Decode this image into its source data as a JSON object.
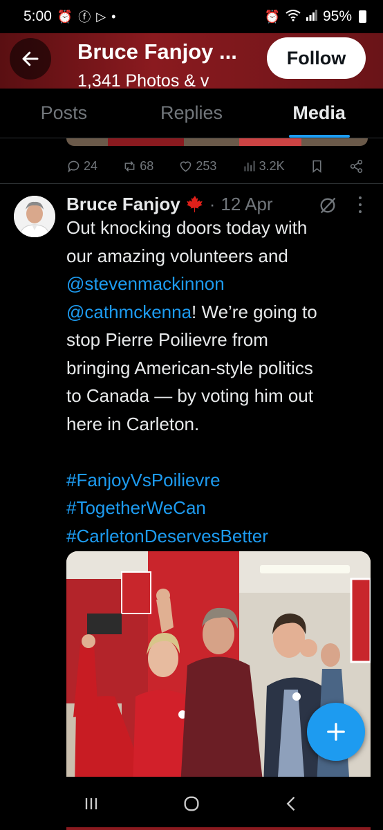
{
  "status_bar": {
    "time": "5:00",
    "dot": "•",
    "battery": "95%",
    "icons": [
      "alarm-icon",
      "facebook-icon",
      "play-icon",
      "wifi-icon",
      "signal-icon",
      "battery-icon"
    ]
  },
  "header": {
    "title": "Bruce Fanjoy ...",
    "subtitle": "1,341 Photos & v",
    "follow_label": "Follow"
  },
  "tabs": [
    {
      "label": "Posts",
      "active": false
    },
    {
      "label": "Replies",
      "active": false
    },
    {
      "label": "Media",
      "active": true
    }
  ],
  "prev_post_actions": {
    "replies": "24",
    "reposts": "68",
    "likes": "253",
    "views": "3.2K"
  },
  "post": {
    "author": "Bruce Fanjoy",
    "separator": "·",
    "date": "12 Apr",
    "text_lines": [
      "Out knocking doors today with",
      "our amazing volunteers and"
    ],
    "mention_1": "@stevenmackinnon",
    "mention_2": "@cathmckenna",
    "after_mention": "! We’re going to",
    "text_lines_2": [
      "stop Pierre Poilievre from",
      "bringing American-style politics",
      "to Canada — by voting him out",
      "here in Carleton."
    ],
    "hashtags": [
      "#FanjoyVsPoilievre",
      "#TogetherWeCan",
      "#CarletonDeservesBetter"
    ]
  },
  "colors": {
    "accent": "#1d9bf0",
    "background": "#000000",
    "text": "#e7e9ea",
    "muted": "#71767b"
  }
}
